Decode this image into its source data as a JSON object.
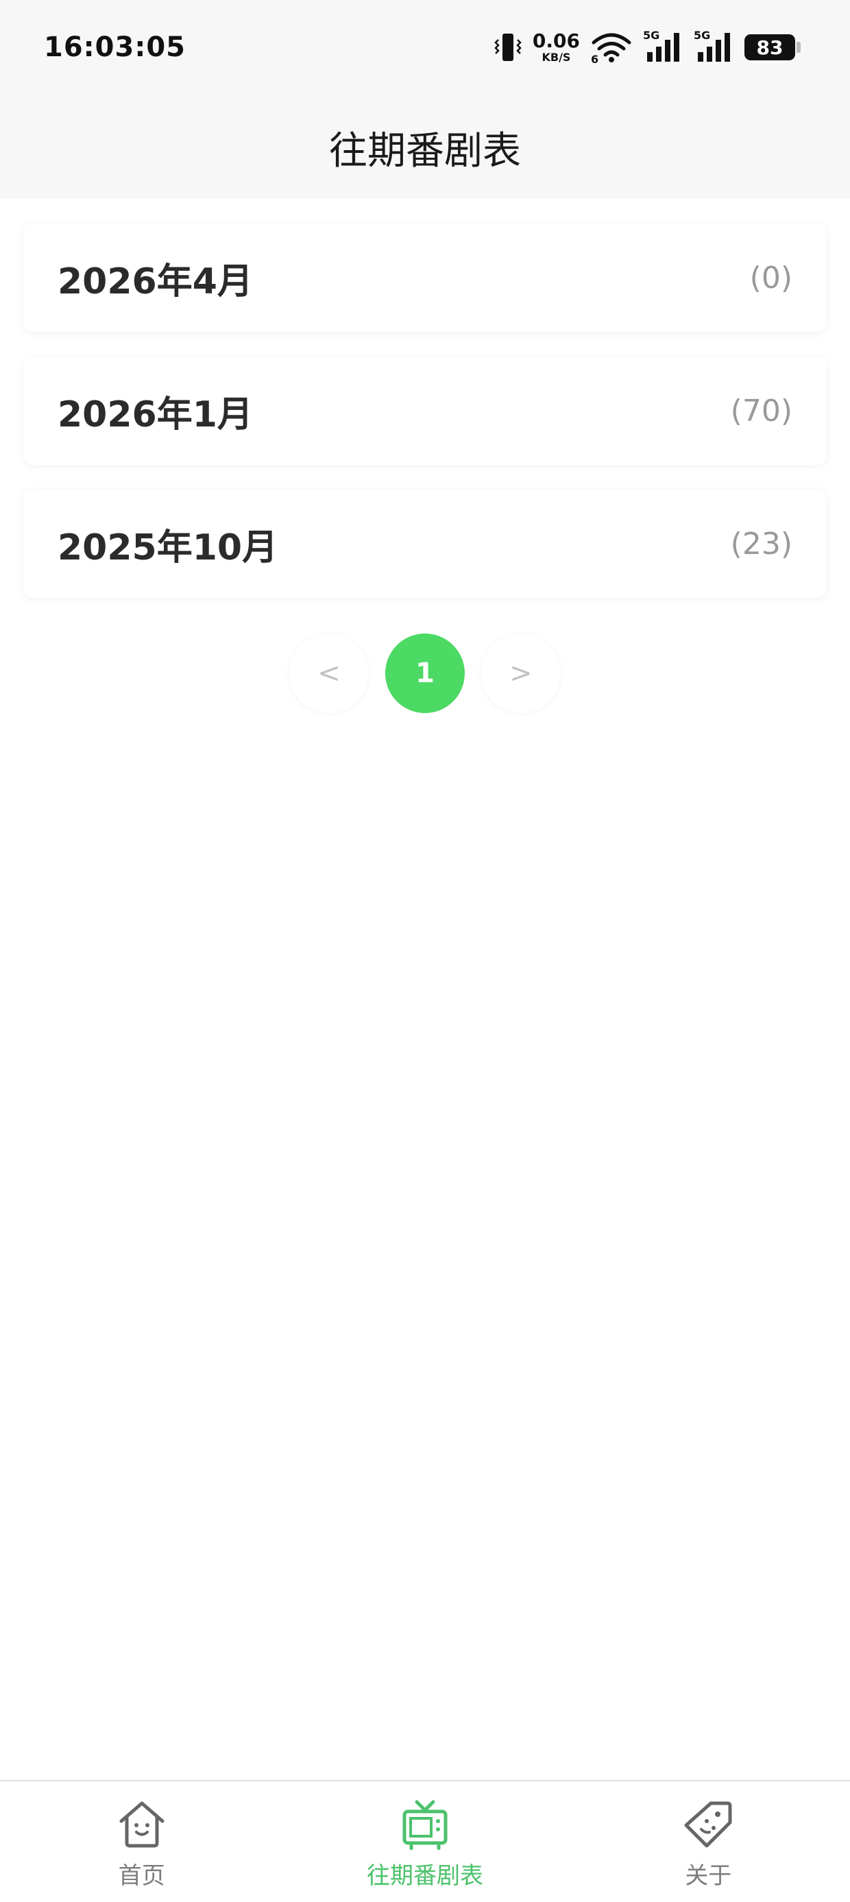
{
  "status_bar": {
    "time": "16:03:05",
    "net_speed_value": "0.06",
    "net_speed_unit": "KB/S",
    "wifi_badge": "6",
    "signal1_label": "5G",
    "signal2_label": "5G",
    "battery_level": "83",
    "icons": [
      "vibrate-icon",
      "wifi-icon",
      "signal-icon",
      "signal-icon",
      "battery-icon"
    ]
  },
  "header": {
    "title": "往期番剧表"
  },
  "seasons": [
    {
      "name": "2026年4月",
      "count": "(0)"
    },
    {
      "name": "2026年1月",
      "count": "(70)"
    },
    {
      "name": "2025年10月",
      "count": "(23)"
    }
  ],
  "pagination": {
    "prev": "<",
    "current": "1",
    "next": ">"
  },
  "tabbar": {
    "items": [
      {
        "label": "首页",
        "icon": "home-icon"
      },
      {
        "label": "往期番剧表",
        "icon": "tv-icon"
      },
      {
        "label": "关于",
        "icon": "tag-icon"
      }
    ],
    "active_index": 1
  },
  "colors": {
    "accent": "#4cd964",
    "tab_active": "#4cc26b",
    "header_bg": "#f7f7f7",
    "muted_text": "#999999"
  }
}
